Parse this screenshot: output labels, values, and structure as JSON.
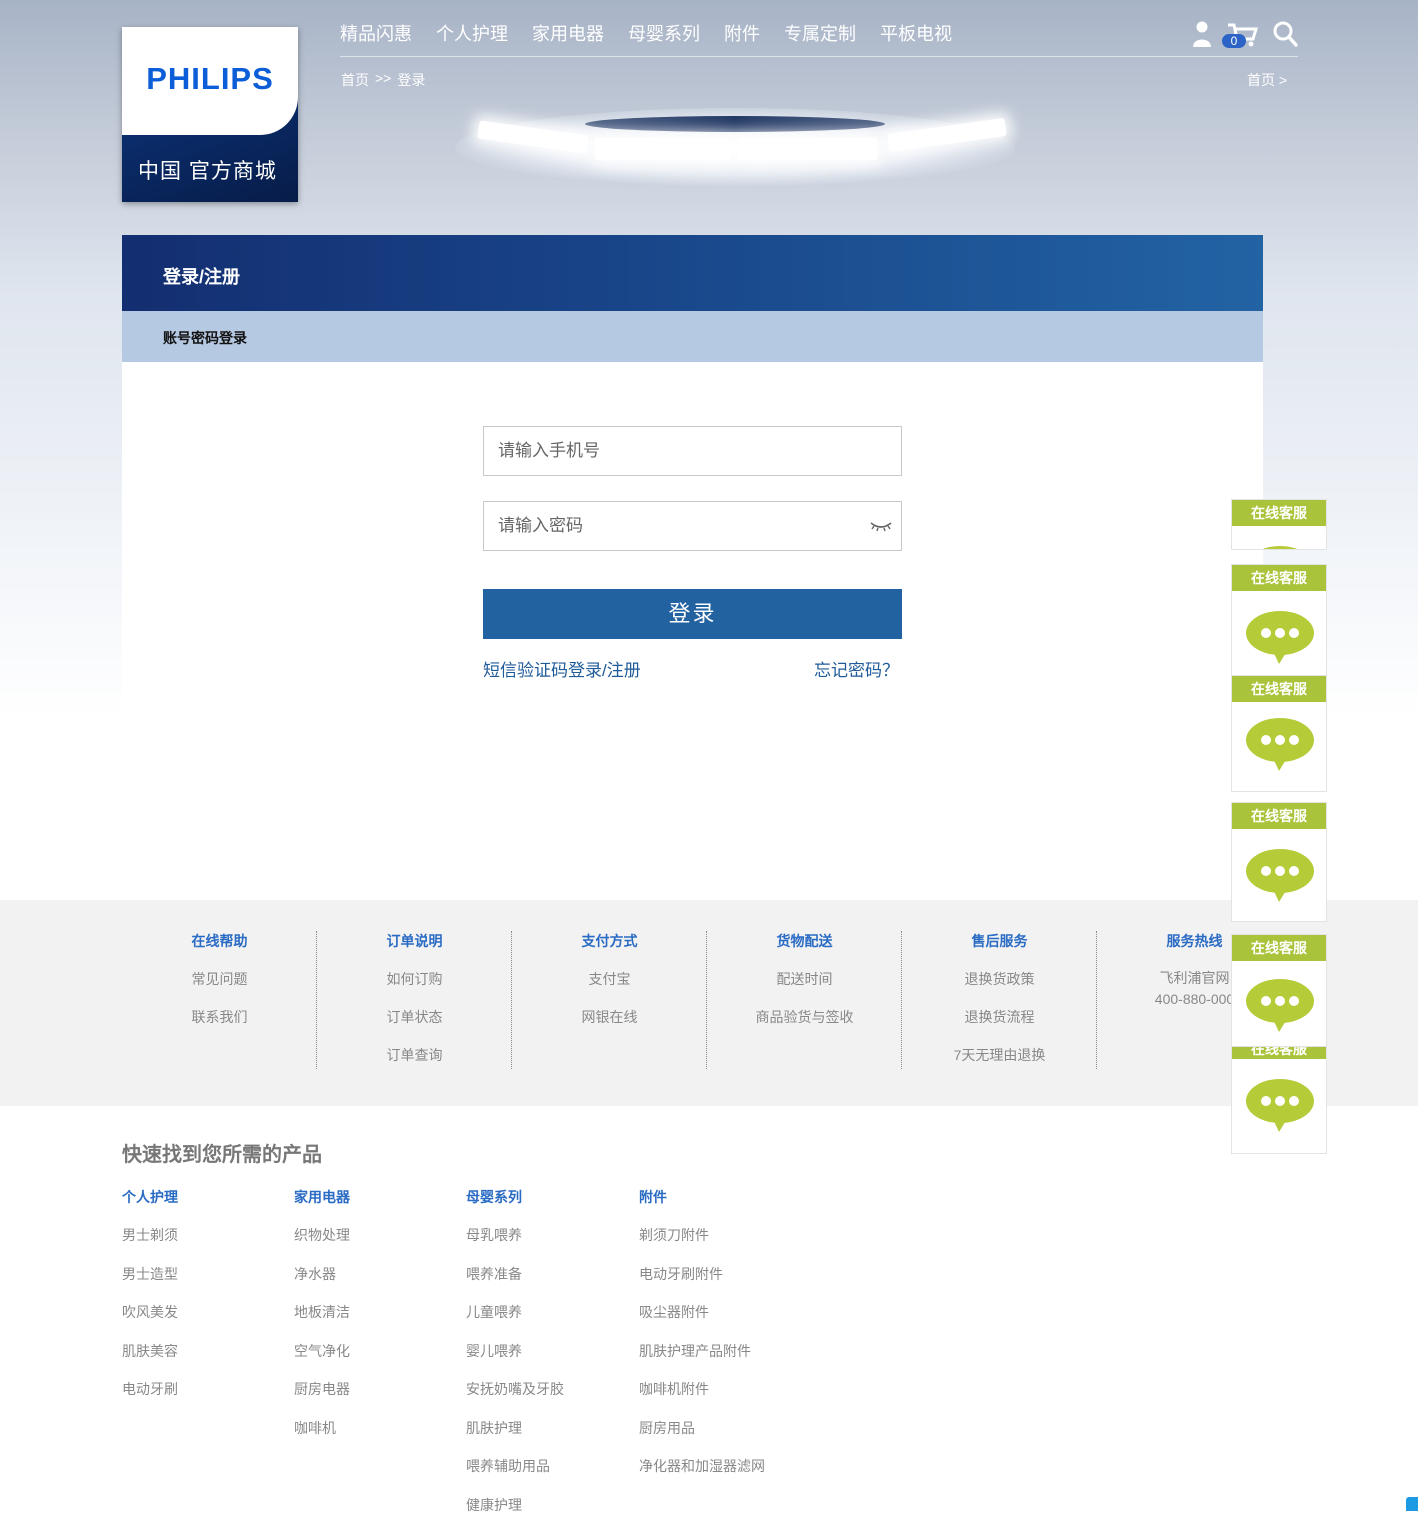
{
  "brand": {
    "logo_word": "PHILIPS",
    "logo_sub": "中国 官方商城",
    "colors": {
      "logo_blue": "#0b5ed7",
      "header_blue": "#132e71",
      "button_blue": "#2262a0",
      "link_blue": "#2a6bc4",
      "cs_green": "#a9c33a"
    }
  },
  "nav": {
    "items": [
      "精品闪惠",
      "个人护理",
      "家用电器",
      "母婴系列",
      "附件",
      "专属定制",
      "平板电视"
    ]
  },
  "header_icons": {
    "user": "user-icon",
    "cart": "cart-icon",
    "cart_count": "0",
    "search": "search-icon"
  },
  "breadcrumb": {
    "home": "首页",
    "separator": ">>",
    "current": "登录",
    "right": "首页 >"
  },
  "login": {
    "title": "登录/注册",
    "tab": "账号密码登录",
    "phone_placeholder": "请输入手机号",
    "password_placeholder": "请输入密码",
    "eye_icon": "eye-closed-icon",
    "submit": "登录",
    "sms_link": "短信验证码登录/注册",
    "forgot_link": "忘记密码？"
  },
  "service": {
    "columns": [
      {
        "title": "在线帮助",
        "items": [
          "常见问题",
          "联系我们"
        ]
      },
      {
        "title": "订单说明",
        "items": [
          "如何订购",
          "订单状态",
          "订单查询"
        ]
      },
      {
        "title": "支付方式",
        "items": [
          "支付宝",
          "网银在线"
        ]
      },
      {
        "title": "货物配送",
        "items": [
          "配送时间",
          "商品验货与签收"
        ]
      },
      {
        "title": "售后服务",
        "items": [
          "退换货政策",
          "退换货流程",
          "7天无理由退换"
        ]
      },
      {
        "title": "服务热线",
        "items": [
          "飞利浦官网",
          "400-880-000"
        ]
      }
    ]
  },
  "quick_find": {
    "title": "快速找到您所需的产品",
    "columns": [
      {
        "title": "个人护理",
        "items": [
          "男士剃须",
          "男士造型",
          "吹风美发",
          "肌肤美容",
          "电动牙刷"
        ]
      },
      {
        "title": "家用电器",
        "items": [
          "织物处理",
          "净水器",
          "地板清洁",
          "空气净化",
          "厨房电器",
          "咖啡机"
        ]
      },
      {
        "title": "母婴系列",
        "items": [
          "母乳喂养",
          "喂养准备",
          "儿童喂养",
          "婴儿喂养",
          "安抚奶嘴及牙胶",
          "肌肤护理",
          "喂养辅助用品",
          "健康护理"
        ]
      },
      {
        "title": "附件",
        "items": [
          "剃须刀附件",
          "电动牙刷附件",
          "吸尘器附件",
          "肌肤护理产品附件",
          "咖啡机附件",
          "厨房用品",
          "净化器和加湿器滤网"
        ]
      }
    ]
  },
  "online_service": {
    "label": "在线客服",
    "icon": "chat-bubble-icon"
  }
}
